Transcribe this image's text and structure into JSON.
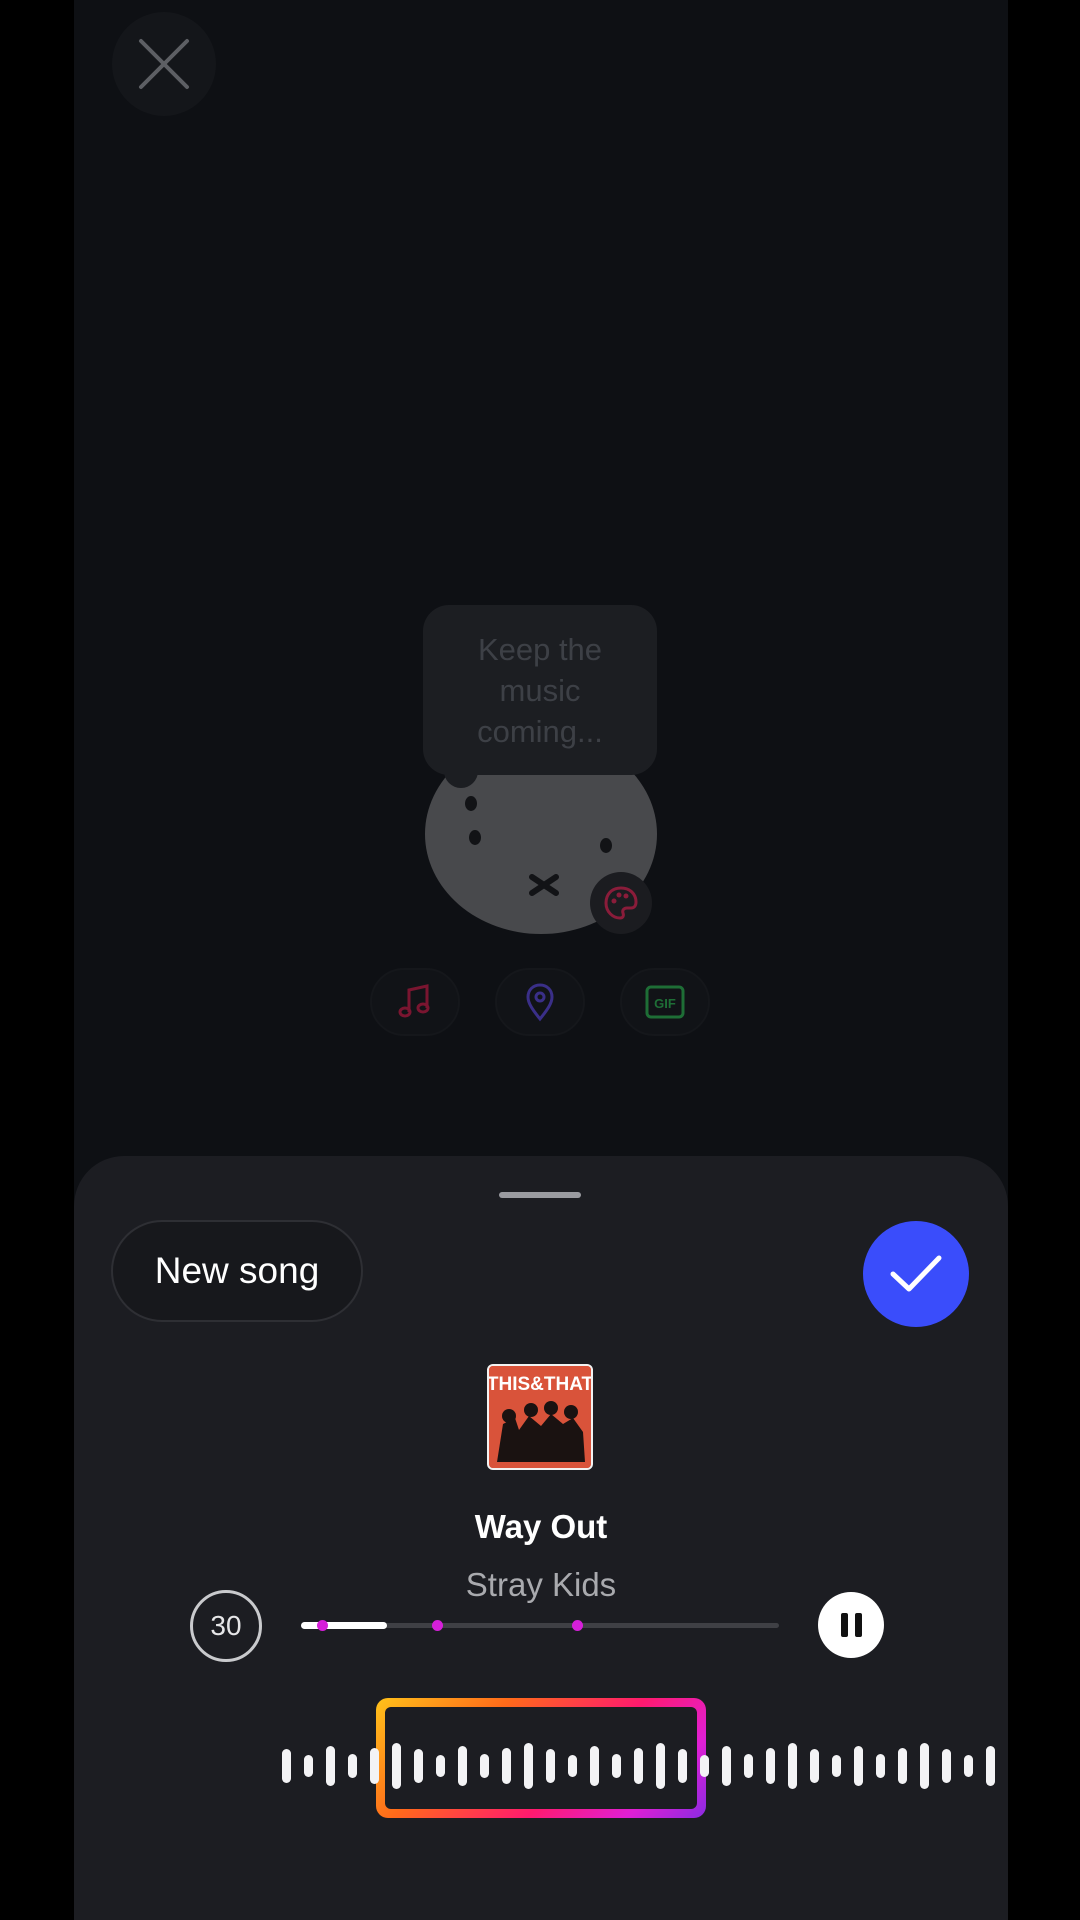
{
  "story_preview": {
    "sticker_bubble_text": "Keep the\nmusic\ncoming...",
    "options": [
      {
        "name": "music",
        "icon": "music-note-icon",
        "color": "#7a1530"
      },
      {
        "name": "location",
        "icon": "location-pin-icon",
        "color": "#3a2f88"
      },
      {
        "name": "gif",
        "icon": "gif-icon",
        "label": "GIF",
        "color": "#1e6e36"
      }
    ]
  },
  "sheet": {
    "new_song_label": "New song",
    "song": {
      "title": "Way Out",
      "artist": "Stray Kids",
      "album_art_text": "THIS&THAT"
    },
    "clip_duration": "30",
    "playback": {
      "progress_fraction": 0.18,
      "state": "playing"
    },
    "accent_color": "#3a4dfb"
  }
}
